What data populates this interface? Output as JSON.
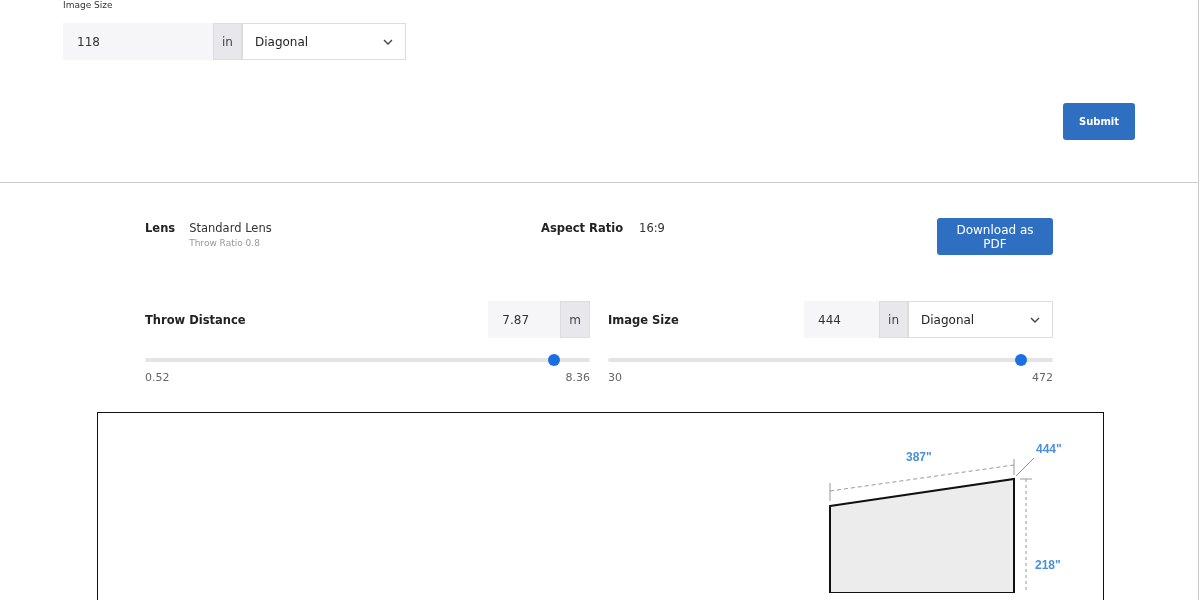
{
  "top_form": {
    "label": "Image Size",
    "value": "118",
    "unit": "in",
    "measure": "Diagonal",
    "submit": "Submit"
  },
  "result": {
    "lens_label": "Lens",
    "lens_name": "Standard Lens",
    "lens_note": "Throw Ratio 0.8",
    "aspect_label": "Aspect Ratio",
    "aspect_value": "16:9",
    "download": "Download as PDF"
  },
  "sliders": [
    {
      "kind": "unit",
      "label": "Throw Distance",
      "value": "7.87",
      "unit": "m",
      "level": 0.92,
      "min": "0.52",
      "max": "8.36"
    },
    {
      "kind": "measure",
      "label": "Image Size",
      "value": "444",
      "unit": "in",
      "measure": "Diagonal",
      "level": 0.927,
      "min": "30",
      "max": "472"
    }
  ],
  "diagram": {
    "width": "387\"",
    "diagonal": "444\"",
    "height": "218\""
  }
}
